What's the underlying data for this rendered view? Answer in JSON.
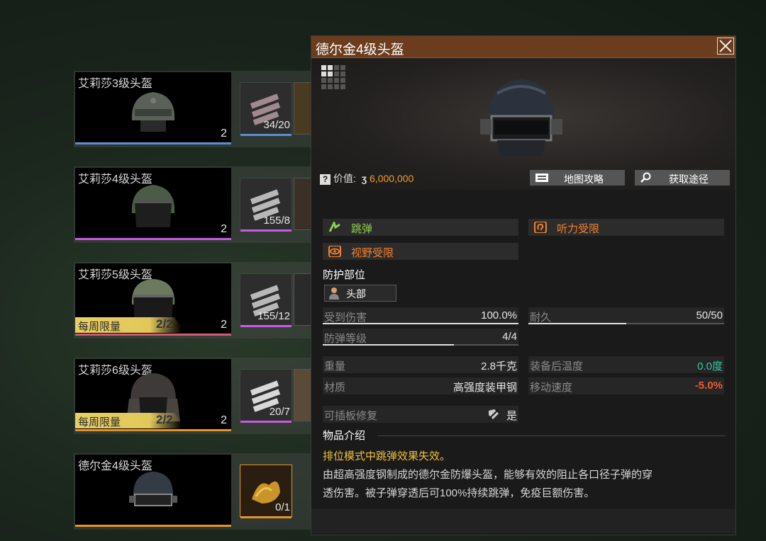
{
  "colors": {
    "blue_bar": "#5b8ecf",
    "purple_bar": "#c65ce0",
    "pink_bar": "#d8577a",
    "orange_bar": "#e8932a",
    "green_tag": "#8fd14f",
    "orange_tag": "#f08030",
    "teal_value": "#35c9a0",
    "warn_value": "#f05a30",
    "price": "#f0a020",
    "desc_yellow": "#f0c040"
  },
  "list": [
    {
      "name": "艾莉莎3级头盔",
      "qty": "2",
      "mat_qty": "34/20",
      "weekly": null
    },
    {
      "name": "艾莉莎4级头盔",
      "qty": "2",
      "mat_qty": "155/8",
      "weekly": null
    },
    {
      "name": "艾莉莎5级头盔",
      "qty": "2",
      "mat_qty": "155/12",
      "weekly": {
        "label": "每周限量",
        "count": "2/2"
      }
    },
    {
      "name": "艾莉莎6级头盔",
      "qty": "2",
      "mat_qty": "20/7",
      "weekly": {
        "label": "每周限量",
        "count": "2/2"
      }
    },
    {
      "name": "德尔金4级头盔",
      "qty": "",
      "mat_qty": "0/1",
      "weekly": null
    }
  ],
  "panel": {
    "title": "德尔金4级头盔",
    "price_label": "价值:",
    "price_value": "6,000,000",
    "map_guide": "地图攻略",
    "obtain": "获取途径",
    "tags": {
      "ricochet": "跳弹",
      "hearing": "听力受限",
      "vision": "视野受限"
    },
    "protect_title": "防护部位",
    "protect_part": "头部",
    "stats": {
      "damage_label": "受到伤害",
      "damage_value": "100.0%",
      "damage_fill": 1.0,
      "durability_label": "耐久",
      "durability_value": "50/50",
      "durability_fill": 0.5,
      "armor_label": "防弹等级",
      "armor_value": "4/4",
      "armor_fill": 0.67,
      "weight_label": "重量",
      "weight_value": "2.8千克",
      "temp_label": "装备后温度",
      "temp_value": "0.0度",
      "material_label": "材质",
      "material_value": "高强度装甲钢",
      "speed_label": "移动速度",
      "speed_value": "-5.0%",
      "repair_label": "可插板修复",
      "repair_value": "是"
    },
    "intro_title": "物品介绍",
    "intro_highlight": "排位模式中跳弹效果失效。",
    "intro_line1": "由超高强度钢制成的德尔金防爆头盔，能够有效的阻止各口径子弹的穿",
    "intro_line2": "透伤害。被子弹穿透后可100%持续跳弹，免疫巨额伤害。"
  }
}
